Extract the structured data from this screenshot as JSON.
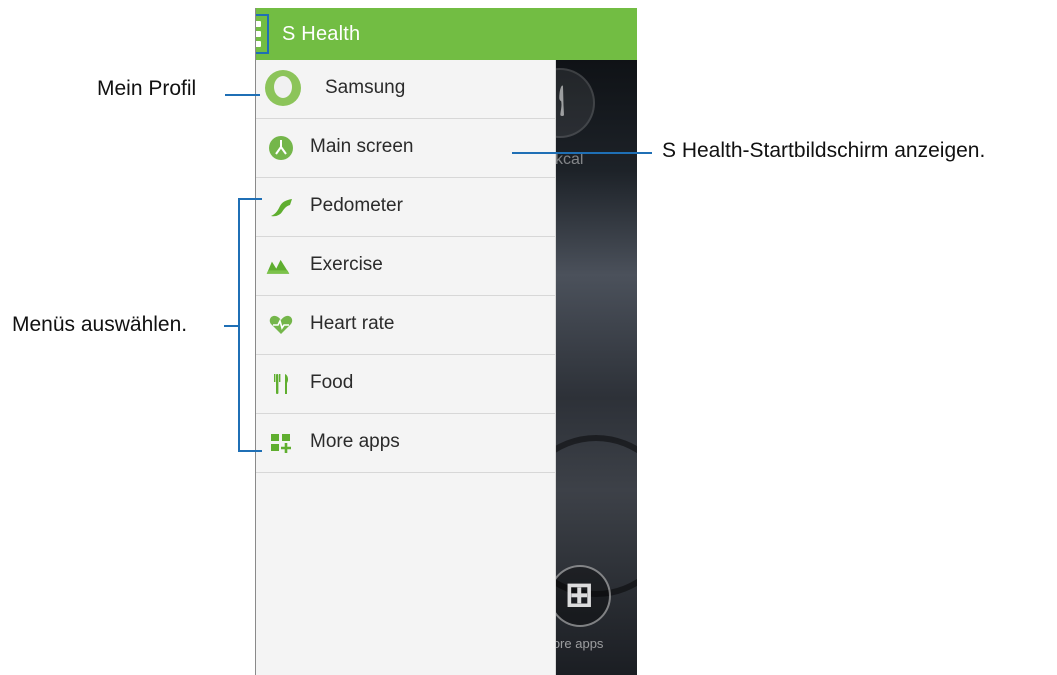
{
  "app": {
    "title": "S Health"
  },
  "drawer": {
    "items": [
      {
        "label": "Samsung",
        "icon": "profile-avatar-icon"
      },
      {
        "label": "Main screen",
        "icon": "main-screen-icon"
      },
      {
        "label": "Pedometer",
        "icon": "pedometer-icon"
      },
      {
        "label": "Exercise",
        "icon": "exercise-icon"
      },
      {
        "label": "Heart rate",
        "icon": "heart-icon"
      },
      {
        "label": "Food",
        "icon": "food-icon"
      },
      {
        "label": "More apps",
        "icon": "more-apps-icon"
      }
    ]
  },
  "background": {
    "kcal_label": "kcal",
    "more_apps_label": "More apps"
  },
  "callouts": {
    "profile": "Mein Profil",
    "main_screen": "S Health-Startbildschirm anzeigen.",
    "menus": "Menüs auswählen."
  },
  "colors": {
    "accent_green": "#72bd43",
    "callout_blue": "#1f6fb5"
  }
}
